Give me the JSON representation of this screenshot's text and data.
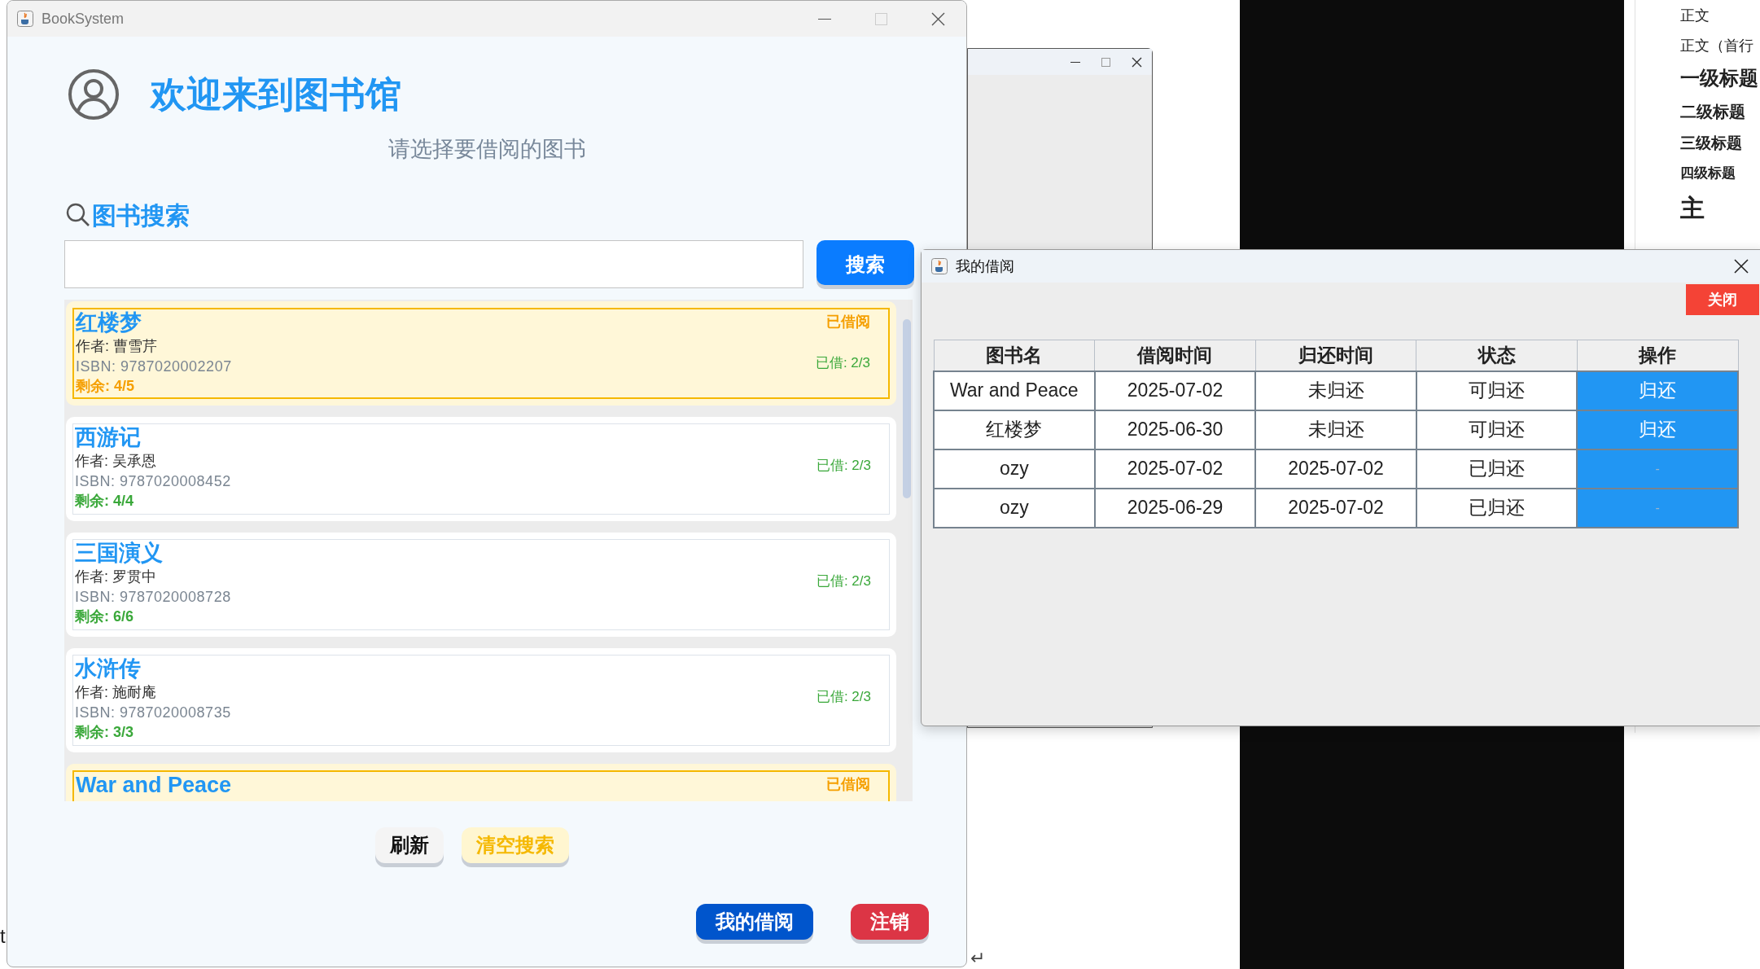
{
  "main_window": {
    "title": "BookSystem",
    "heading": "欢迎来到图书馆",
    "subtitle": "请选择要借阅的图书",
    "search_label": "图书搜索",
    "search_button": "搜索",
    "books": [
      {
        "title": "红楼梦",
        "author": "作者: 曹雪芹",
        "isbn": "ISBN: 9787020002207",
        "remaining": "剩余: 4/5",
        "status": "已借阅",
        "borrowed_count": "已借: 2/3",
        "selected": true
      },
      {
        "title": "西游记",
        "author": "作者: 吴承恩",
        "isbn": "ISBN: 9787020008452",
        "remaining": "剩余: 4/4",
        "borrowed_count": "已借: 2/3",
        "selected": false
      },
      {
        "title": "三国演义",
        "author": "作者: 罗贯中",
        "isbn": "ISBN: 9787020008728",
        "remaining": "剩余: 6/6",
        "borrowed_count": "已借: 2/3",
        "selected": false
      },
      {
        "title": "水浒传",
        "author": "作者: 施耐庵",
        "isbn": "ISBN: 9787020008735",
        "remaining": "剩余: 3/3",
        "borrowed_count": "已借: 2/3",
        "selected": false
      },
      {
        "title": "War and Peace",
        "status": "已借阅",
        "selected": true
      }
    ],
    "buttons": [
      "刷新",
      "清空搜索"
    ],
    "footer_buttons": [
      "我的借阅",
      "注销"
    ]
  },
  "dialog": {
    "title": "我的借阅",
    "close_button": "关闭",
    "columns": [
      "图书名",
      "借阅时间",
      "归还时间",
      "状态",
      "操作"
    ],
    "rows": [
      {
        "cells": [
          "War and Peace",
          "2025-07-02",
          "未归还",
          "可归还"
        ],
        "action": "归还",
        "disabled": false
      },
      {
        "cells": [
          "红楼梦",
          "2025-06-30",
          "未归还",
          "可归还"
        ],
        "action": "归还",
        "disabled": false
      },
      {
        "cells": [
          "ozy",
          "2025-07-02",
          "2025-07-02",
          "已归还"
        ],
        "action": "-",
        "disabled": true
      },
      {
        "cells": [
          "ozy",
          "2025-06-29",
          "2025-07-02",
          "已归还"
        ],
        "action": "-",
        "disabled": true
      }
    ]
  },
  "styles_panel": [
    {
      "label": "正文",
      "kind": "normal"
    },
    {
      "label": "正文（首行",
      "kind": "normal"
    },
    {
      "label": "一级标题",
      "kind": "h1"
    },
    {
      "label": "二级标题",
      "kind": "h2"
    },
    {
      "label": "三级标题",
      "kind": "h3"
    },
    {
      "label": "四级标题",
      "kind": "h4"
    },
    {
      "label": "主",
      "kind": "title"
    }
  ],
  "stray_text": "t",
  "return_mark": "↵"
}
